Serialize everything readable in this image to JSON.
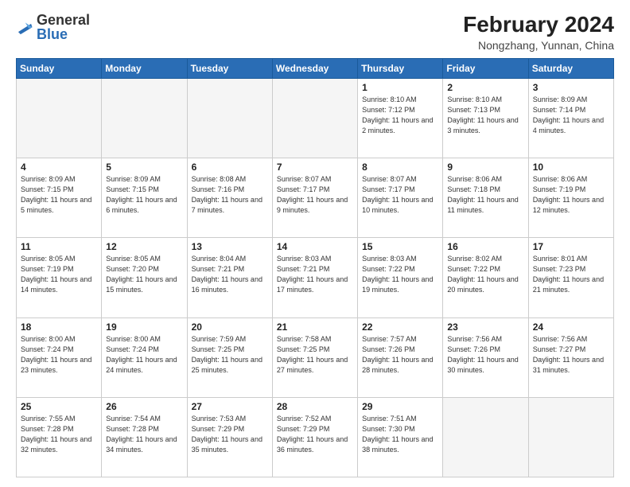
{
  "logo": {
    "text_general": "General",
    "text_blue": "Blue"
  },
  "header": {
    "month_year": "February 2024",
    "location": "Nongzhang, Yunnan, China"
  },
  "days_of_week": [
    "Sunday",
    "Monday",
    "Tuesday",
    "Wednesday",
    "Thursday",
    "Friday",
    "Saturday"
  ],
  "weeks": [
    [
      {
        "day": "",
        "info": ""
      },
      {
        "day": "",
        "info": ""
      },
      {
        "day": "",
        "info": ""
      },
      {
        "day": "",
        "info": ""
      },
      {
        "day": "1",
        "info": "Sunrise: 8:10 AM\nSunset: 7:12 PM\nDaylight: 11 hours\nand 2 minutes."
      },
      {
        "day": "2",
        "info": "Sunrise: 8:10 AM\nSunset: 7:13 PM\nDaylight: 11 hours\nand 3 minutes."
      },
      {
        "day": "3",
        "info": "Sunrise: 8:09 AM\nSunset: 7:14 PM\nDaylight: 11 hours\nand 4 minutes."
      }
    ],
    [
      {
        "day": "4",
        "info": "Sunrise: 8:09 AM\nSunset: 7:15 PM\nDaylight: 11 hours\nand 5 minutes."
      },
      {
        "day": "5",
        "info": "Sunrise: 8:09 AM\nSunset: 7:15 PM\nDaylight: 11 hours\nand 6 minutes."
      },
      {
        "day": "6",
        "info": "Sunrise: 8:08 AM\nSunset: 7:16 PM\nDaylight: 11 hours\nand 7 minutes."
      },
      {
        "day": "7",
        "info": "Sunrise: 8:07 AM\nSunset: 7:17 PM\nDaylight: 11 hours\nand 9 minutes."
      },
      {
        "day": "8",
        "info": "Sunrise: 8:07 AM\nSunset: 7:17 PM\nDaylight: 11 hours\nand 10 minutes."
      },
      {
        "day": "9",
        "info": "Sunrise: 8:06 AM\nSunset: 7:18 PM\nDaylight: 11 hours\nand 11 minutes."
      },
      {
        "day": "10",
        "info": "Sunrise: 8:06 AM\nSunset: 7:19 PM\nDaylight: 11 hours\nand 12 minutes."
      }
    ],
    [
      {
        "day": "11",
        "info": "Sunrise: 8:05 AM\nSunset: 7:19 PM\nDaylight: 11 hours\nand 14 minutes."
      },
      {
        "day": "12",
        "info": "Sunrise: 8:05 AM\nSunset: 7:20 PM\nDaylight: 11 hours\nand 15 minutes."
      },
      {
        "day": "13",
        "info": "Sunrise: 8:04 AM\nSunset: 7:21 PM\nDaylight: 11 hours\nand 16 minutes."
      },
      {
        "day": "14",
        "info": "Sunrise: 8:03 AM\nSunset: 7:21 PM\nDaylight: 11 hours\nand 17 minutes."
      },
      {
        "day": "15",
        "info": "Sunrise: 8:03 AM\nSunset: 7:22 PM\nDaylight: 11 hours\nand 19 minutes."
      },
      {
        "day": "16",
        "info": "Sunrise: 8:02 AM\nSunset: 7:22 PM\nDaylight: 11 hours\nand 20 minutes."
      },
      {
        "day": "17",
        "info": "Sunrise: 8:01 AM\nSunset: 7:23 PM\nDaylight: 11 hours\nand 21 minutes."
      }
    ],
    [
      {
        "day": "18",
        "info": "Sunrise: 8:00 AM\nSunset: 7:24 PM\nDaylight: 11 hours\nand 23 minutes."
      },
      {
        "day": "19",
        "info": "Sunrise: 8:00 AM\nSunset: 7:24 PM\nDaylight: 11 hours\nand 24 minutes."
      },
      {
        "day": "20",
        "info": "Sunrise: 7:59 AM\nSunset: 7:25 PM\nDaylight: 11 hours\nand 25 minutes."
      },
      {
        "day": "21",
        "info": "Sunrise: 7:58 AM\nSunset: 7:25 PM\nDaylight: 11 hours\nand 27 minutes."
      },
      {
        "day": "22",
        "info": "Sunrise: 7:57 AM\nSunset: 7:26 PM\nDaylight: 11 hours\nand 28 minutes."
      },
      {
        "day": "23",
        "info": "Sunrise: 7:56 AM\nSunset: 7:26 PM\nDaylight: 11 hours\nand 30 minutes."
      },
      {
        "day": "24",
        "info": "Sunrise: 7:56 AM\nSunset: 7:27 PM\nDaylight: 11 hours\nand 31 minutes."
      }
    ],
    [
      {
        "day": "25",
        "info": "Sunrise: 7:55 AM\nSunset: 7:28 PM\nDaylight: 11 hours\nand 32 minutes."
      },
      {
        "day": "26",
        "info": "Sunrise: 7:54 AM\nSunset: 7:28 PM\nDaylight: 11 hours\nand 34 minutes."
      },
      {
        "day": "27",
        "info": "Sunrise: 7:53 AM\nSunset: 7:29 PM\nDaylight: 11 hours\nand 35 minutes."
      },
      {
        "day": "28",
        "info": "Sunrise: 7:52 AM\nSunset: 7:29 PM\nDaylight: 11 hours\nand 36 minutes."
      },
      {
        "day": "29",
        "info": "Sunrise: 7:51 AM\nSunset: 7:30 PM\nDaylight: 11 hours\nand 38 minutes."
      },
      {
        "day": "",
        "info": ""
      },
      {
        "day": "",
        "info": ""
      }
    ]
  ]
}
